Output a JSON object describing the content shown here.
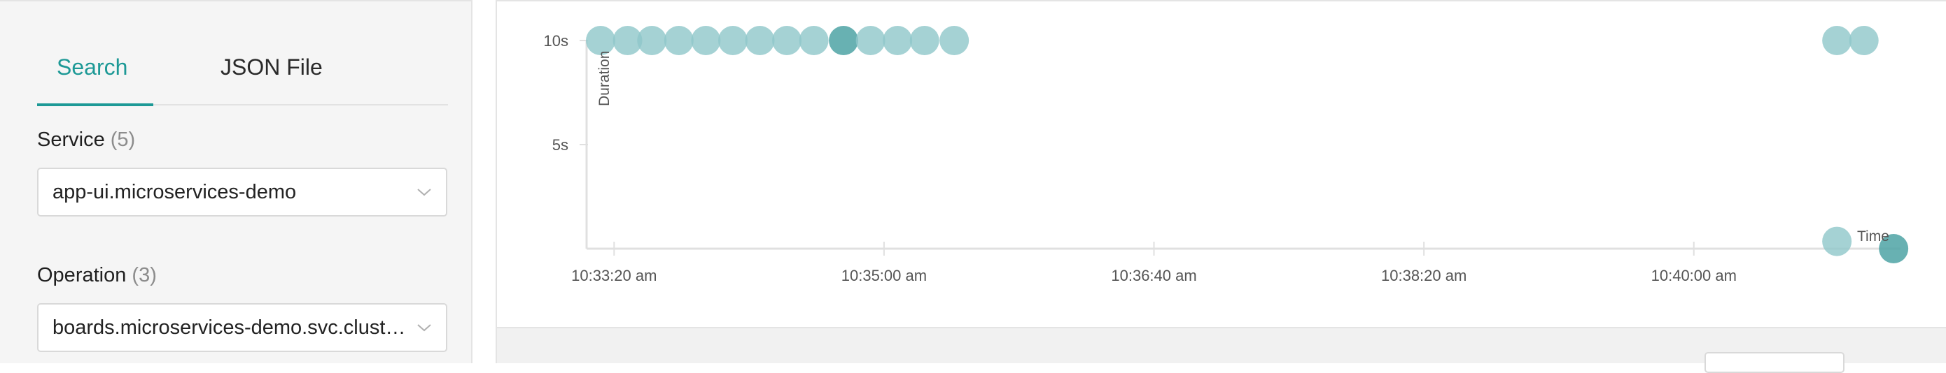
{
  "search_panel": {
    "tabs": [
      {
        "label": "Search",
        "active": true
      },
      {
        "label": "JSON File",
        "active": false
      }
    ],
    "service": {
      "label": "Service",
      "count": "(5)",
      "value": "app-ui.microservices-demo"
    },
    "operation": {
      "label": "Operation",
      "count": "(3)",
      "value": "boards.microservices-demo.svc.cluster..."
    }
  },
  "colors": {
    "accent": "#1d9996",
    "point": "#8ec7c9",
    "point_dark": "#4ea3a5"
  },
  "chart_data": {
    "type": "scatter",
    "ylabel": "Duration",
    "xlabel": "Time",
    "y_ticks": [
      "10s",
      "5s"
    ],
    "y_tick_values": [
      10,
      5
    ],
    "x_ticks": [
      "10:33:20 am",
      "10:35:00 am",
      "10:36:40 am",
      "10:38:20 am",
      "10:40:00 am"
    ],
    "x_tick_values": [
      0,
      100,
      200,
      300,
      400
    ],
    "xlim": [
      -5,
      475
    ],
    "ylim": [
      0,
      10
    ],
    "series": [
      {
        "points": [
          {
            "x": -5,
            "y": 10
          },
          {
            "x": 5,
            "y": 10
          },
          {
            "x": 14,
            "y": 10
          },
          {
            "x": 24,
            "y": 10
          },
          {
            "x": 34,
            "y": 10
          },
          {
            "x": 44,
            "y": 10
          },
          {
            "x": 54,
            "y": 10
          },
          {
            "x": 64,
            "y": 10
          },
          {
            "x": 74,
            "y": 10
          },
          {
            "x": 85,
            "y": 10,
            "highlight": true
          },
          {
            "x": 95,
            "y": 10
          },
          {
            "x": 105,
            "y": 10
          },
          {
            "x": 115,
            "y": 10
          },
          {
            "x": 126,
            "y": 10
          },
          {
            "x": 453,
            "y": 10
          },
          {
            "x": 463,
            "y": 10
          },
          {
            "x": 453,
            "y": 0.35
          },
          {
            "x": 474,
            "y": 0,
            "highlight": true
          }
        ]
      }
    ]
  }
}
